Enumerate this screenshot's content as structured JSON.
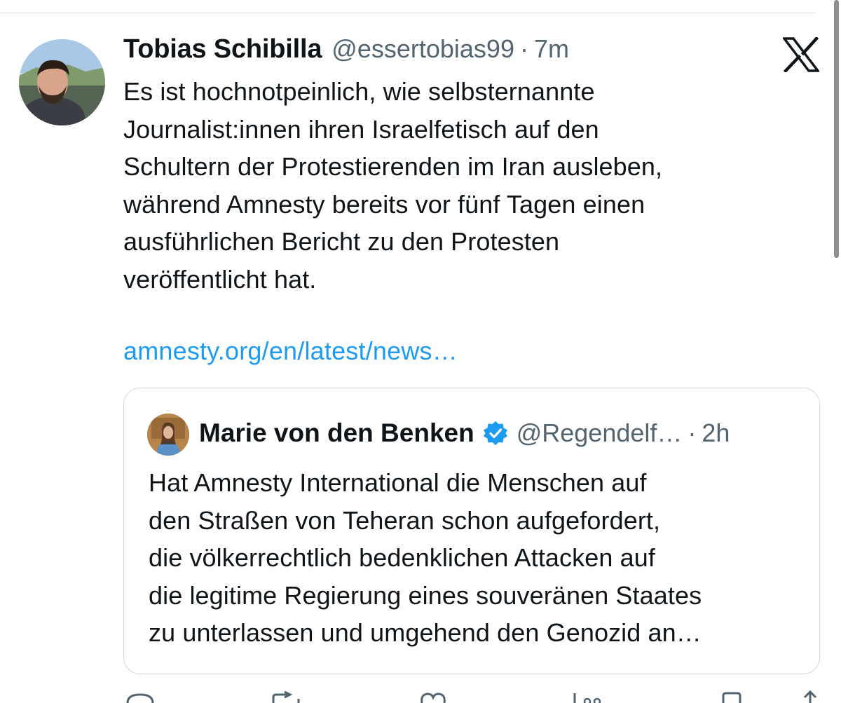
{
  "tweet": {
    "author_name": "Tobias Schibilla",
    "handle": "@essertobias99",
    "separator": "·",
    "time": "7m",
    "text": "Es ist hochnotpeinlich, wie selbsternannte\nJournalist:innen ihren Israelfetisch auf den\nSchultern der Protestierenden im Iran ausleben,\nwährend Amnesty bereits vor fünf Tagen einen\nausführlichen Bericht zu den Protesten\nveröffentlicht hat.",
    "link": "amnesty.org/en/latest/news…"
  },
  "quoted_tweet": {
    "author_name": "Marie von den Benken",
    "handle": "@Regendelf…",
    "separator": "·",
    "time": "2h",
    "text": "Hat Amnesty International die Menschen auf\nden Straßen von Teheran schon aufgefordert,\ndie völkerrechtlich bedenklichen Attacken auf\ndie legitime Regierung eines souveränen Staates\nzu unterlassen und umgehend den Genozid an…"
  },
  "icons": {
    "platform_logo": "x-logo-icon",
    "verified": "verified-badge-icon",
    "actions": [
      "reply-icon",
      "repost-icon",
      "like-icon",
      "views-icon",
      "bookmark-icon",
      "share-icon"
    ]
  },
  "colors": {
    "text": "#0f1419",
    "secondary": "#536471",
    "link": "#1d9bf0",
    "border": "#cfd9de",
    "verified": "#1d9bf0"
  }
}
